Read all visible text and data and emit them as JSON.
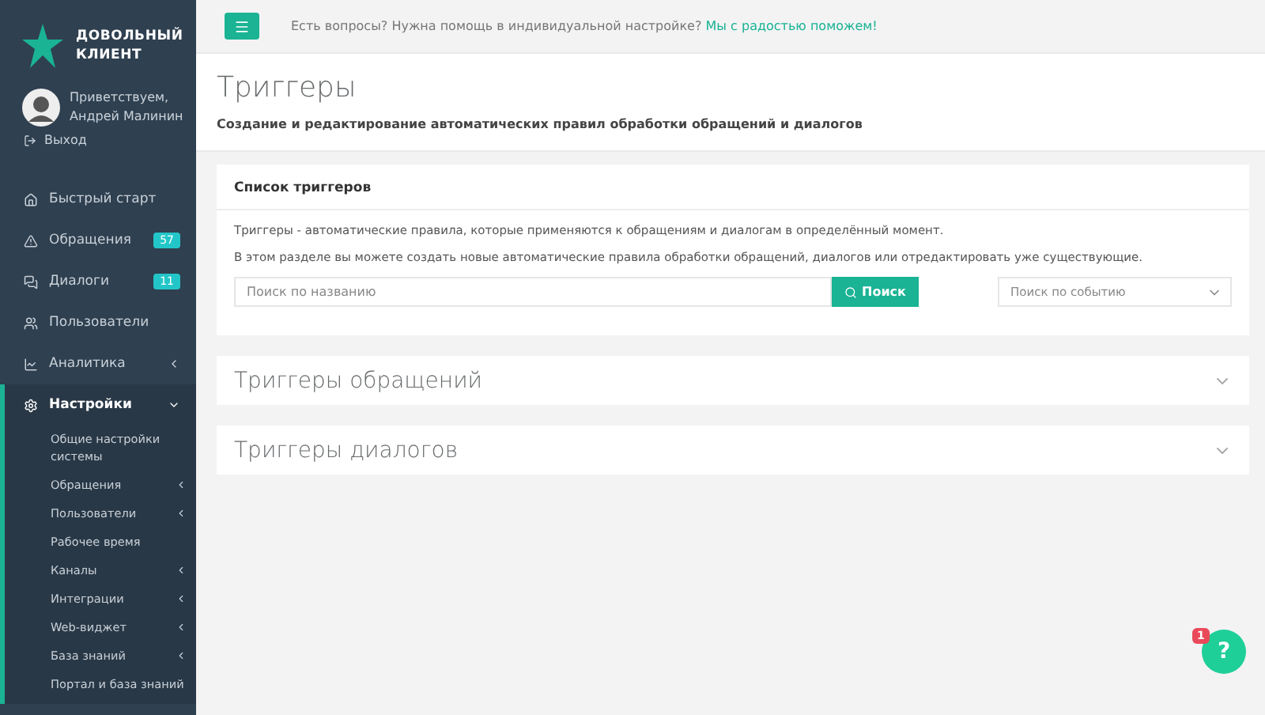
{
  "logo": {
    "line_1": "ДОВОЛЬНЫЙ",
    "line_2": "КЛИЕНТ"
  },
  "user": {
    "greeting": "Приветствуем,",
    "name": "Андрей Малинин",
    "logout": "Выход"
  },
  "nav": [
    {
      "label": "Быстрый старт",
      "has_arrow": false,
      "selected": false
    },
    {
      "label": "Обращения",
      "badge": "57",
      "has_arrow": false,
      "selected": false
    },
    {
      "label": "Диалоги",
      "badge": "11",
      "has_arrow": false,
      "selected": false
    },
    {
      "label": "Пользователи",
      "has_arrow": false,
      "selected": false
    },
    {
      "label": "Аналитика",
      "has_arrow": true,
      "expanded": false,
      "selected": false
    },
    {
      "label": "Настройки",
      "has_arrow": true,
      "expanded": true,
      "selected": true,
      "children": [
        {
          "label": "Общие настройки системы",
          "has_arrow": false
        },
        {
          "label": "Обращения",
          "has_arrow": true
        },
        {
          "label": "Пользователи",
          "has_arrow": true
        },
        {
          "label": "Рабочее время",
          "has_arrow": false
        },
        {
          "label": "Каналы",
          "has_arrow": true
        },
        {
          "label": "Интеграции",
          "has_arrow": true
        },
        {
          "label": "Web-виджет",
          "has_arrow": true
        },
        {
          "label": "База знаний",
          "has_arrow": true
        },
        {
          "label": "Портал и база знаний",
          "has_arrow": false
        }
      ]
    }
  ],
  "topbar": {
    "question": "Есть вопросы? Нужна помощь в индивидуальной настройке?",
    "link": "Мы с радостью поможем!"
  },
  "page": {
    "title": "Триггеры",
    "subtitle": "Создание и редактирование автоматических правил обработки обращений и диалогов"
  },
  "list_panel": {
    "title": "Список триггеров",
    "text_1": "Триггеры - автоматические правила, которые применяются к обращениям и диалогам в определённый момент.",
    "text_2": "В этом разделе вы можете создать новые автоматические правила обработки обращений, диалогов или отредактировать уже существующие.",
    "search_placeholder": "Поиск по названию",
    "search_button": "Поиск",
    "event_placeholder": "Поиск по событию"
  },
  "sections": [
    {
      "title": "Триггеры обращений",
      "expanded": false
    },
    {
      "title": "Триггеры диалогов",
      "expanded": false
    }
  ],
  "help": {
    "label": "?",
    "badge": "1"
  }
}
